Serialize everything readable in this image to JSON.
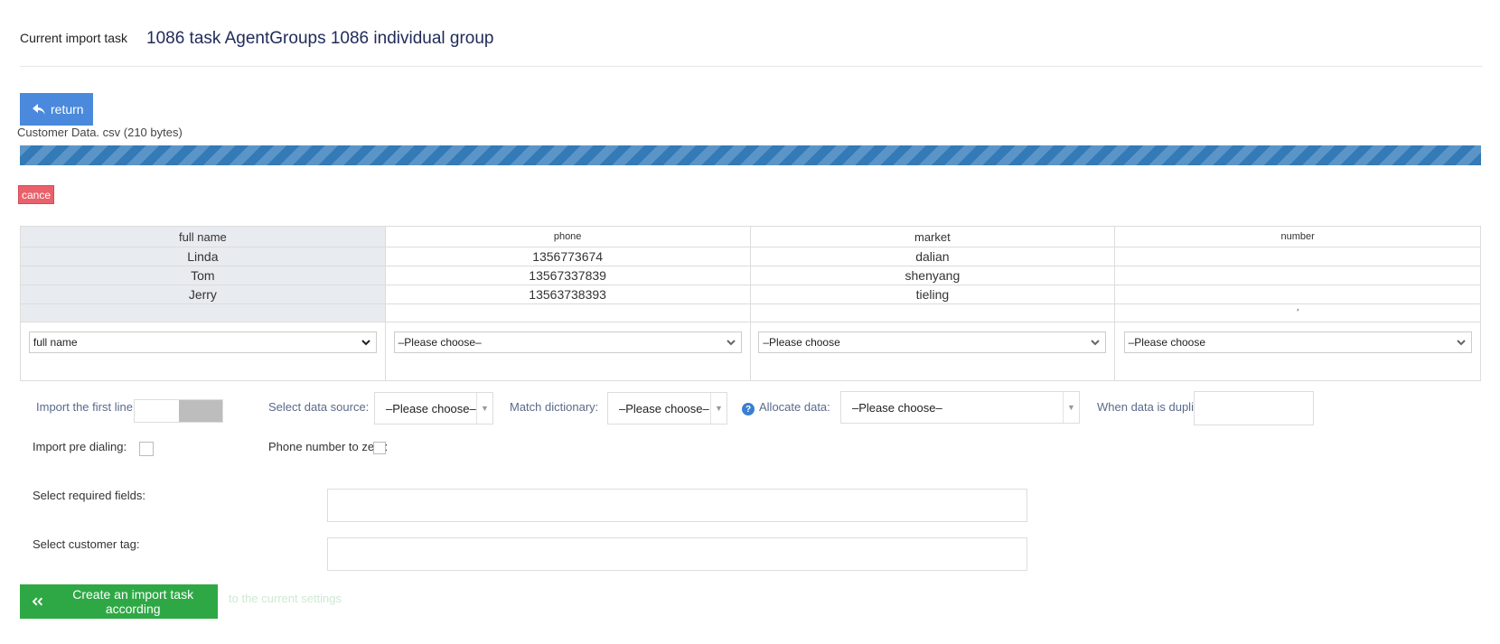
{
  "header": {
    "task_label": "Current import task",
    "task_name": "1086 task AgentGroups 1086 individual group"
  },
  "toolbar": {
    "return_label": "return",
    "return_icon": "reply-icon"
  },
  "upload": {
    "file_info": "Customer Data. csv (210 bytes)",
    "cancel_label": "cance"
  },
  "preview": {
    "columns": [
      "full name",
      "phone",
      "market",
      "number"
    ],
    "rows": [
      [
        "Linda",
        "1356773674",
        "dalian",
        ""
      ],
      [
        "Tom",
        "13567337839",
        "shenyang",
        ""
      ],
      [
        "Jerry",
        "13563738393",
        "tieling",
        ""
      ]
    ],
    "trailing_mark": "′",
    "mappings": [
      "full name",
      "–Please choose–",
      "–Please choose",
      "–Please choose"
    ]
  },
  "settings": {
    "import_first_line_label": "Import the first line:",
    "data_source_label": "Select data source:",
    "data_source_value": "–Please choose–",
    "dictionary_label": "Match dictionary:",
    "dictionary_value": "–Please choose–",
    "allocate_label": "Allocate data:",
    "allocate_value": "–Please choose–",
    "duplicated_label": "When data is duplicated:",
    "pre_dialing_label": "Import pre dialing:",
    "phone_zero_label": "Phone number to zero:",
    "required_fields_label": "Select required fields:",
    "customer_tag_label": "Select customer tag:",
    "help_icon": "question-circle-icon"
  },
  "footer": {
    "create_label": "Create an import task according",
    "create_overflow": "to the current settings",
    "create_icon": "double-chevron-left-icon"
  },
  "colors": {
    "primary": "#4a89dc",
    "danger": "#e8616b",
    "success": "#2ea845",
    "progress": "#337ab7",
    "header_cell": "#e8ebef"
  }
}
